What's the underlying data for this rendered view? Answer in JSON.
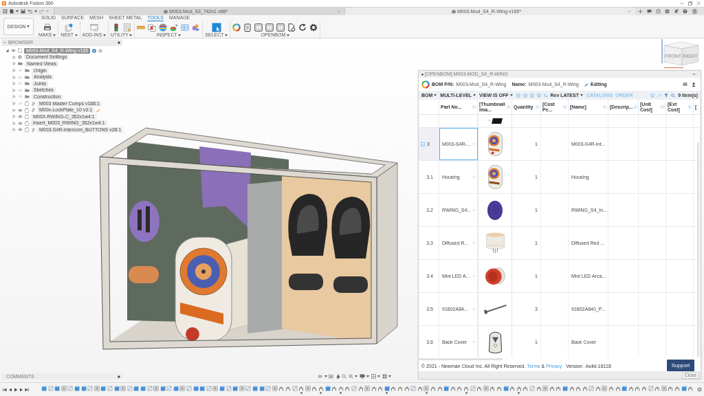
{
  "window": {
    "title": "Autodesk Fusion 360"
  },
  "document_tabs": [
    {
      "title": "M003-Mod_S3_742x1 v68*",
      "selected": false
    },
    {
      "title": "M003-Mod_S4_R-Wing v165*",
      "selected": true
    }
  ],
  "toolbar": {
    "workspace": "DESIGN",
    "tabs": [
      {
        "label": "SOLID",
        "selected": false
      },
      {
        "label": "SURFACE",
        "selected": false
      },
      {
        "label": "MESH",
        "selected": false
      },
      {
        "label": "SHEET METAL",
        "selected": false
      },
      {
        "label": "TOOLS",
        "selected": true
      },
      {
        "label": "MANAGE",
        "selected": false
      }
    ],
    "groups": [
      "MAKE",
      "NEST",
      "ADD-INS",
      "UTILITY",
      "INSPECT",
      "SELECT",
      "OPENBOM"
    ]
  },
  "browser": {
    "title": "BROWSER",
    "tree": [
      {
        "label": "M003-Mod_S4_R-Wing v165",
        "kind": "document",
        "expanded": true,
        "visible": true,
        "selected": true,
        "children": [
          {
            "label": "Document Settings",
            "kind": "settings",
            "expanded": false,
            "selected": false
          },
          {
            "label": "Named Views",
            "kind": "folder",
            "expanded": false,
            "selected": false
          },
          {
            "label": "Origin",
            "kind": "folder",
            "expanded": false,
            "visible": false,
            "selected": false
          },
          {
            "label": "Analysis",
            "kind": "folder",
            "expanded": false,
            "visible": false,
            "selected": false
          },
          {
            "label": "Joints",
            "kind": "folder",
            "expanded": false,
            "visible": false,
            "selected": false
          },
          {
            "label": "Sketches",
            "kind": "folder",
            "expanded": false,
            "visible": false,
            "selected": false
          },
          {
            "label": "Construction",
            "kind": "folder",
            "expanded": false,
            "visible": false,
            "selected": false
          },
          {
            "label": "M003 Master Comps v188:1",
            "kind": "component",
            "expanded": false,
            "visible": false,
            "linked": true,
            "modified": false,
            "selected": false
          },
          {
            "label": "M00x-LockPlate_10 v3:1",
            "kind": "component",
            "expanded": false,
            "visible": true,
            "linked": true,
            "modified": true,
            "selected": false
          },
          {
            "label": "M00X-RWING-C_352x1w4:1",
            "kind": "component",
            "expanded": false,
            "visible": true,
            "linked": false,
            "modified": false,
            "selected": false
          },
          {
            "label": "Insert_M003_RWING_352x1w4:1",
            "kind": "component",
            "expanded": false,
            "visible": true,
            "linked": false,
            "modified": false,
            "selected": false
          },
          {
            "label": "M003-S4R-Intercom_BUTTONS v28:1",
            "kind": "component",
            "expanded": false,
            "visible": true,
            "linked": true,
            "modified": false,
            "selected": false
          }
        ]
      }
    ]
  },
  "viewcube": {
    "labels": [
      "FRONT",
      "RIGHT"
    ]
  },
  "comments": {
    "title": "COMMENTS"
  },
  "bom": {
    "window_title": "[OPENBOM] M003-MOD_S4_R-WING",
    "pn_label": "BOM P/N:",
    "pn": "M003-Mod_S4_R-Wing",
    "name_label": "Name:",
    "name": "M003-Mod_S4_R-Wing",
    "status": "Editing",
    "menus": [
      "BOM",
      "MULTI-LEVEL",
      "VIEW IS OFF"
    ],
    "revision": "Rev LATEST",
    "links": [
      "CATALOGS",
      "ORDER"
    ],
    "count": "9 item(s)",
    "columns": [
      "Part No...",
      "[Thumbnail ima...",
      "Quantity",
      "[Cost Pe...",
      "[Name]",
      "[Descrip...",
      "[Unit Cost]",
      "[Ext Cost]",
      "["
    ],
    "rows": [
      {
        "number": "3",
        "part_no": "M003-S4R-...",
        "quantity": "1",
        "name": "M003-S4R-Int...",
        "selected": true,
        "expanded": true,
        "children": [
          {
            "number": "3.1",
            "part_no": "Housing",
            "quantity": "1",
            "name": "Housing",
            "selected": false
          },
          {
            "number": "3.2",
            "part_no": "RWING_S4...",
            "quantity": "1",
            "name": "RWING_S4_In...",
            "selected": false
          },
          {
            "number": "3.3",
            "part_no": "Diffused R...",
            "quantity": "1",
            "name": "Diffused Red ...",
            "selected": false
          },
          {
            "number": "3.4",
            "part_no": "Mini LED A...",
            "quantity": "1",
            "name": "Mini LED Arca...",
            "selected": false
          },
          {
            "number": "3.5",
            "part_no": "91802A84...",
            "quantity": "3",
            "name": "91802A840_P...",
            "selected": false
          },
          {
            "number": "3.6",
            "part_no": "Back Cover",
            "quantity": "1",
            "name": "Back Cover",
            "selected": false
          }
        ]
      }
    ],
    "footer": {
      "copyright": "© 2021 - Newman Cloud Inc. All Right Reserved.",
      "terms": "Terms",
      "conjunction": "&",
      "privacy": "Privacy",
      "version": "Version: -build-16118"
    },
    "support": "Support",
    "close": "Close"
  }
}
